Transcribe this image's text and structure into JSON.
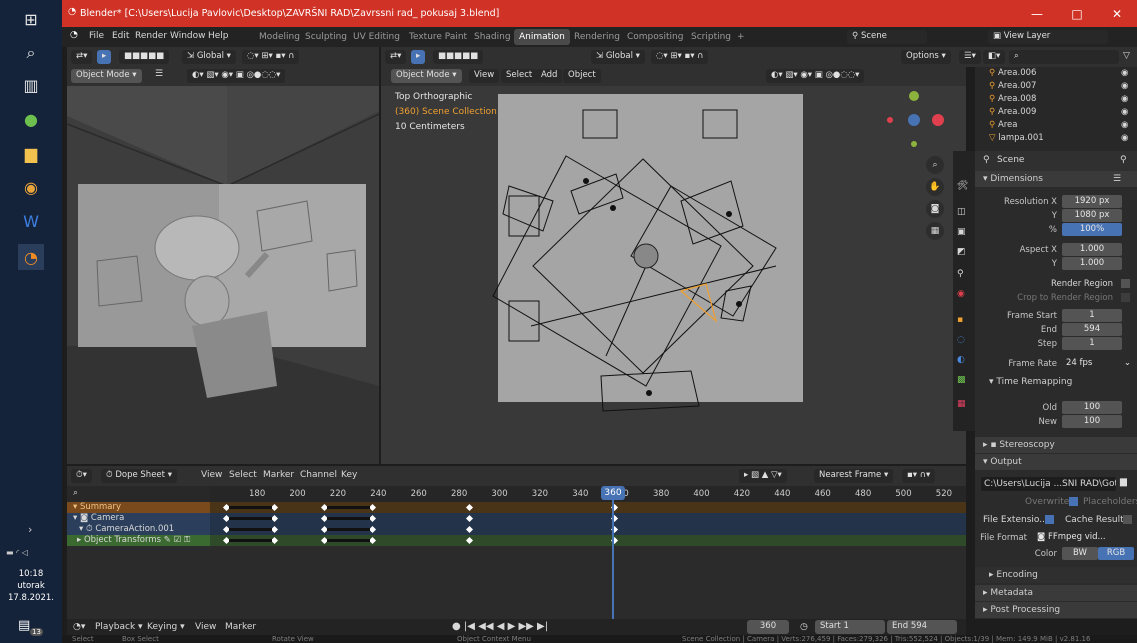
{
  "taskbar": {
    "icons": [
      "windows-icon",
      "search-icon",
      "taskview-icon",
      "utorrent-icon",
      "file-explorer-icon",
      "chrome-icon",
      "word-icon",
      "blender-icon"
    ],
    "clock_time": "10:18",
    "clock_day": "utorak",
    "clock_date": "17.8.2021.",
    "notification_count": "13"
  },
  "window": {
    "title": "Blender* [C:\\Users\\Lucija Pavlovic\\Desktop\\ZAVRŠNI RAD\\Zavrssni rad_ pokusaj 3.blend]",
    "minimize": "—",
    "maximize": "□",
    "close": "✕"
  },
  "topbar": {
    "menus": [
      "File",
      "Edit",
      "Render",
      "Window",
      "Help"
    ],
    "workspaces": [
      "Modeling",
      "Sculpting",
      "UV Editing",
      "Texture Paint",
      "Shading",
      "Animation",
      "Rendering",
      "Compositing",
      "Scripting"
    ],
    "active_workspace": "Animation",
    "scene_label": "Scene",
    "view_layer": "View Layer"
  },
  "left_viewport": {
    "orientation": "Global",
    "mode": "Object Mode"
  },
  "right_viewport": {
    "orientation": "Global",
    "mode": "Object Mode",
    "menus": [
      "View",
      "Select",
      "Add",
      "Object"
    ],
    "options": "Options",
    "overlay_title": "Top Orthographic",
    "overlay_collection": "(360) Scene Collection | Camera",
    "overlay_scale": "10 Centimeters"
  },
  "dope_sheet": {
    "editor": "Dope Sheet",
    "menus": [
      "View",
      "Select",
      "Marker",
      "Channel",
      "Key"
    ],
    "snapping": "Nearest Frame",
    "frames": [
      "180",
      "200",
      "220",
      "240",
      "260",
      "280",
      "300",
      "320",
      "340",
      "360",
      "380",
      "400",
      "420",
      "440",
      "460",
      "480",
      "500",
      "520"
    ],
    "current_frame": "360",
    "channels": [
      "Summary",
      "Camera",
      "CameraAction.001",
      "Object Transforms"
    ]
  },
  "timeline": {
    "menus": [
      "Playback",
      "Keying",
      "View",
      "Marker"
    ],
    "current_frame": "360",
    "start_label": "Start",
    "start": "1",
    "end_label": "End",
    "end": "594"
  },
  "status": {
    "select": "Select",
    "box_select": "Box Select",
    "rotate": "Rotate View",
    "context": "Object Context Menu",
    "info": "Scene Collection | Camera | Verts:276,459 | Faces:279,326 | Tris:552,524 | Objects:1/39 | Mem: 149.9 MiB | v2.81.16"
  },
  "outliner": {
    "items": [
      "Area.006",
      "Area.007",
      "Area.008",
      "Area.009",
      "Area",
      "lampa.001"
    ]
  },
  "properties": {
    "scene": "Scene",
    "dimensions": "Dimensions",
    "resolution_x_label": "Resolution X",
    "resolution_x": "1920 px",
    "resolution_y_label": "Y",
    "resolution_y": "1080 px",
    "percent_label": "%",
    "percent": "100%",
    "aspect_x_label": "Aspect X",
    "aspect_x": "1.000",
    "aspect_y_label": "Y",
    "aspect_y": "1.000",
    "render_region": "Render Region",
    "crop": "Crop to Render Region",
    "frame_start_label": "Frame Start",
    "frame_start": "1",
    "end_label": "End",
    "end": "594",
    "step_label": "Step",
    "step": "1",
    "frame_rate_label": "Frame Rate",
    "frame_rate": "24 fps",
    "time_remapping": "Time Remapping",
    "old_label": "Old",
    "old": "100",
    "new_label": "New",
    "new": "100",
    "stereoscopy": "Stereoscopy",
    "output": "Output",
    "output_path": "C:\\Users\\Lucija ...SNI RAD\\Gotovo\\",
    "overwrite": "Overwrite",
    "placeholders": "Placeholders",
    "file_extensions": "File Extensio..",
    "cache_result": "Cache Result",
    "file_format_label": "File Format",
    "file_format": "FFmpeg vid...",
    "color_label": "Color",
    "bw": "BW",
    "rgb": "RGB",
    "encoding": "Encoding",
    "metadata": "Metadata",
    "post_processing": "Post Processing"
  },
  "colors": {
    "accent": "#4772b3",
    "title_red": "#d03226",
    "selection_orange": "#f0a030",
    "playhead": "#4772b3"
  }
}
